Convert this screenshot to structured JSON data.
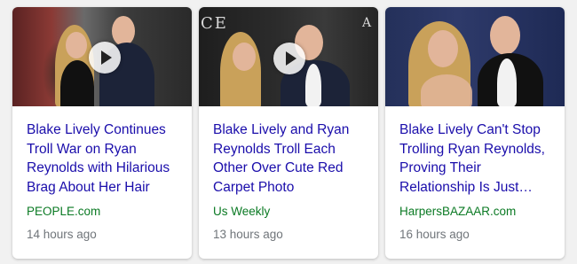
{
  "cards": [
    {
      "headline": "Blake Lively Continues Troll War on Ryan Reynolds with Hilarious Brag About Her Hair",
      "source": "PEOPLE.com",
      "time": "14 hours ago",
      "thumbnail_icon": "video-thumbnail",
      "has_video": true
    },
    {
      "headline": "Blake Lively and Ryan Reynolds Troll Each Other Over Cute Red Carpet Photo",
      "source": "Us Weekly",
      "time": "13 hours ago",
      "thumbnail_icon": "video-thumbnail",
      "has_video": true
    },
    {
      "headline": "Blake Lively Can't Stop Trolling Ryan Reynolds, Proving Their Relationship Is Just…",
      "source": "HarpersBAZAAR.com",
      "time": "16 hours ago",
      "thumbnail_icon": "image-thumbnail",
      "has_video": false
    }
  ],
  "thumbnail_text": {
    "card2_left": "CE",
    "card2_right": "A"
  },
  "colors": {
    "headline": "#1a0dab",
    "source": "#0b7a24",
    "time": "#70757a",
    "card_bg": "#ffffff",
    "page_bg": "#f1f1f1"
  }
}
